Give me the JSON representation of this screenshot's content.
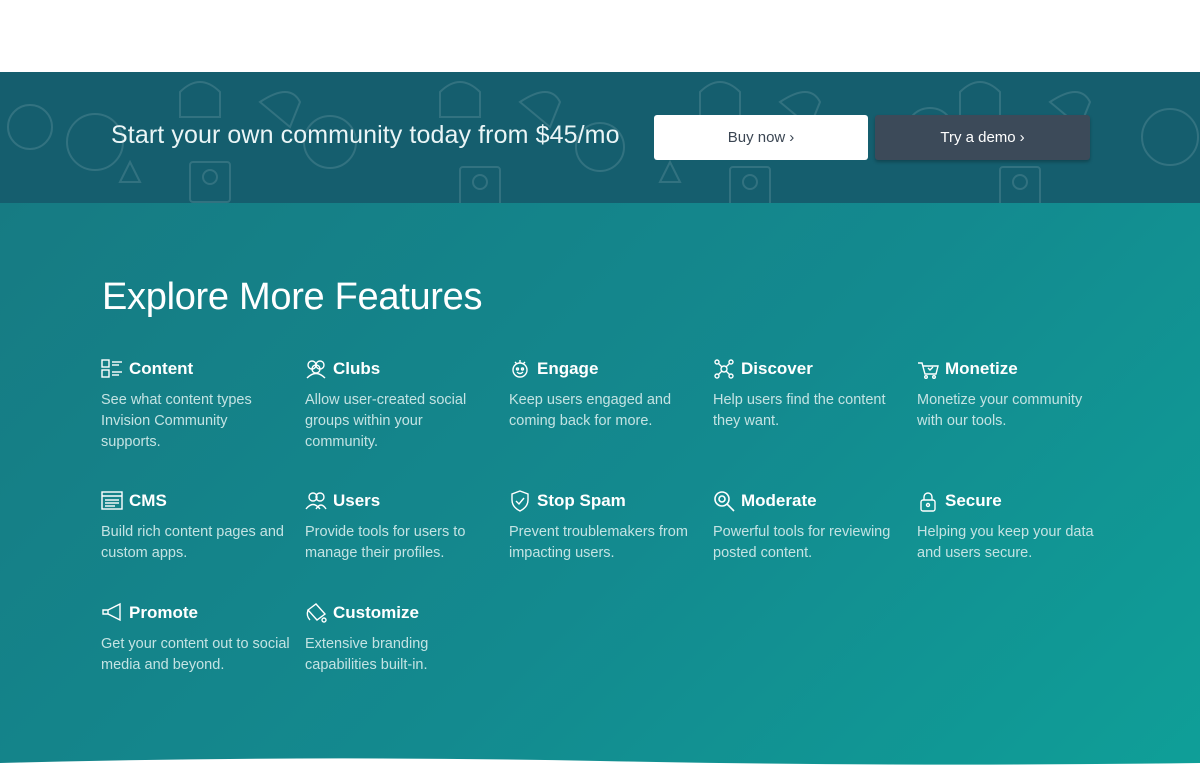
{
  "cta": {
    "headline": "Start your own community today from $45/mo",
    "buy_label": "Buy now",
    "demo_label": "Try a demo",
    "chevron": "›"
  },
  "section": {
    "title": "Explore More Features"
  },
  "features": [
    {
      "icon": "content-icon",
      "title": "Content",
      "desc": "See what content types Invision Community supports."
    },
    {
      "icon": "clubs-icon",
      "title": "Clubs",
      "desc": "Allow user-created social groups within your community."
    },
    {
      "icon": "engage-icon",
      "title": "Engage",
      "desc": "Keep users engaged and coming back for more."
    },
    {
      "icon": "discover-icon",
      "title": "Discover",
      "desc": "Help users find the content they want."
    },
    {
      "icon": "monetize-icon",
      "title": "Monetize",
      "desc": "Monetize your community with our tools."
    },
    {
      "icon": "cms-icon",
      "title": "CMS",
      "desc": "Build rich content pages and custom apps."
    },
    {
      "icon": "users-icon",
      "title": "Users",
      "desc": "Provide tools for users to manage their profiles."
    },
    {
      "icon": "shield-icon",
      "title": "Stop Spam",
      "desc": "Prevent troublemakers from impacting users."
    },
    {
      "icon": "magnifier-icon",
      "title": "Moderate",
      "desc": "Powerful tools for reviewing posted content."
    },
    {
      "icon": "lock-icon",
      "title": "Secure",
      "desc": "Helping you keep your data and users secure."
    },
    {
      "icon": "megaphone-icon",
      "title": "Promote",
      "desc": "Get your content out to social media and beyond."
    },
    {
      "icon": "paint-bucket-icon",
      "title": "Customize",
      "desc": "Extensive branding capabilities built-in."
    }
  ],
  "colors": {
    "cta_band": "#155e6e",
    "features_gradient_start": "#167b83",
    "features_gradient_end": "#0f9f98",
    "demo_button": "#3c4a59"
  }
}
